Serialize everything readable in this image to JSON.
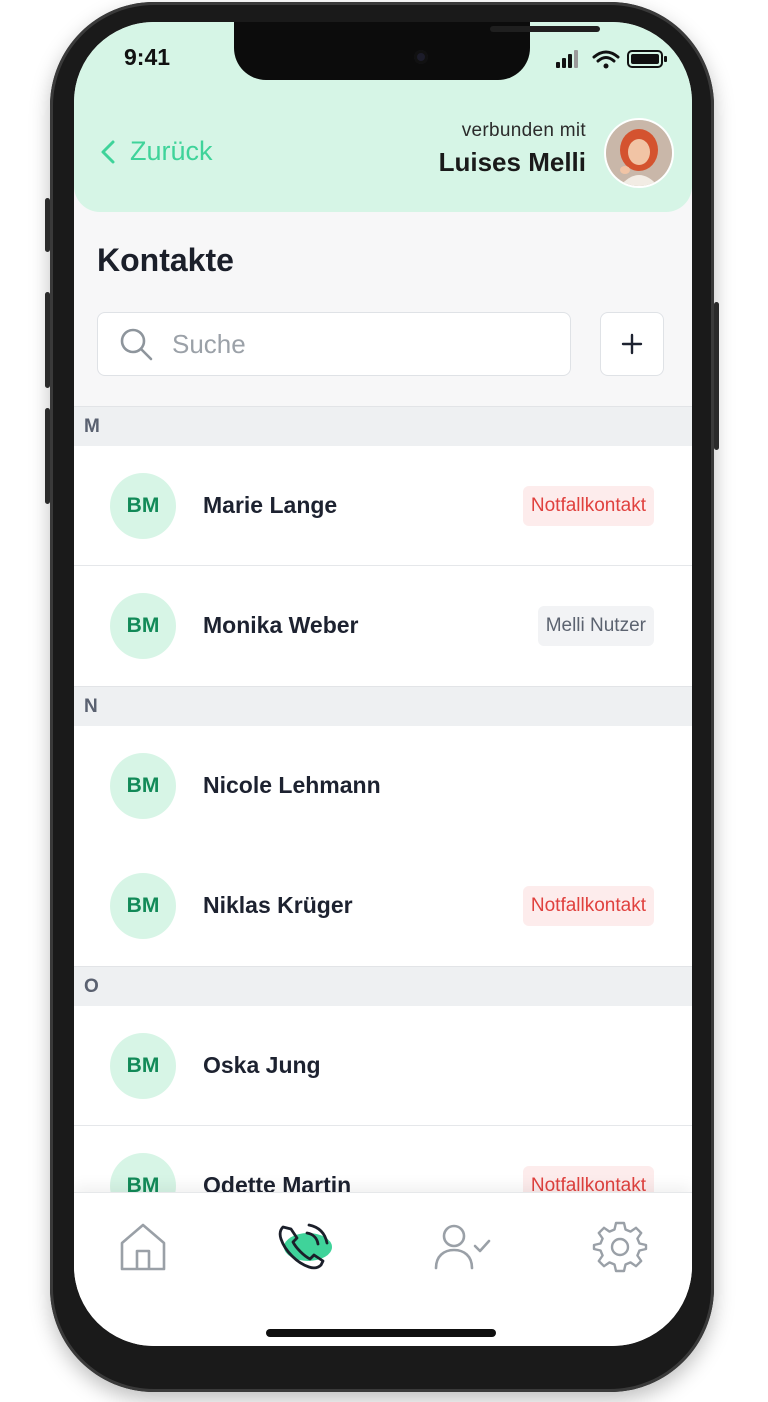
{
  "status_bar": {
    "time": "9:41"
  },
  "header": {
    "back_label": "Zurück",
    "connected_label": "verbunden mit",
    "connected_name": "Luises Melli"
  },
  "page": {
    "title": "Kontakte"
  },
  "search": {
    "placeholder": "Suche",
    "value": ""
  },
  "contacts": {
    "sections": [
      {
        "letter": "M",
        "items": [
          {
            "initials": "BM",
            "name": "Marie Lange",
            "badge": "Notfallkontakt",
            "badge_type": "emergency"
          },
          {
            "initials": "BM",
            "name": "Monika Weber",
            "badge": "Melli Nutzer",
            "badge_type": "user"
          }
        ]
      },
      {
        "letter": "N",
        "items": [
          {
            "initials": "BM",
            "name": "Nicole Lehmann",
            "badge": "",
            "badge_type": ""
          },
          {
            "initials": "BM",
            "name": "Niklas Krüger",
            "badge": "Notfallkontakt",
            "badge_type": "emergency"
          }
        ]
      },
      {
        "letter": "O",
        "items": [
          {
            "initials": "BM",
            "name": "Oska Jung",
            "badge": "",
            "badge_type": ""
          },
          {
            "initials": "BM",
            "name": "Odette Martin",
            "badge": "Notfallkontakt",
            "badge_type": "emergency"
          }
        ]
      }
    ]
  },
  "tabbar": {
    "tabs": [
      {
        "icon": "home-icon",
        "active": false
      },
      {
        "icon": "phone-icon",
        "active": true
      },
      {
        "icon": "user-check-icon",
        "active": false
      },
      {
        "icon": "gear-icon",
        "active": false
      }
    ]
  },
  "colors": {
    "accent": "#3fd39a",
    "header_bg": "#d6f5e6",
    "avatar_bg": "#d7f5e6",
    "avatar_text": "#128a58",
    "emergency_text": "#e0413e",
    "emergency_bg": "#fdecec"
  }
}
